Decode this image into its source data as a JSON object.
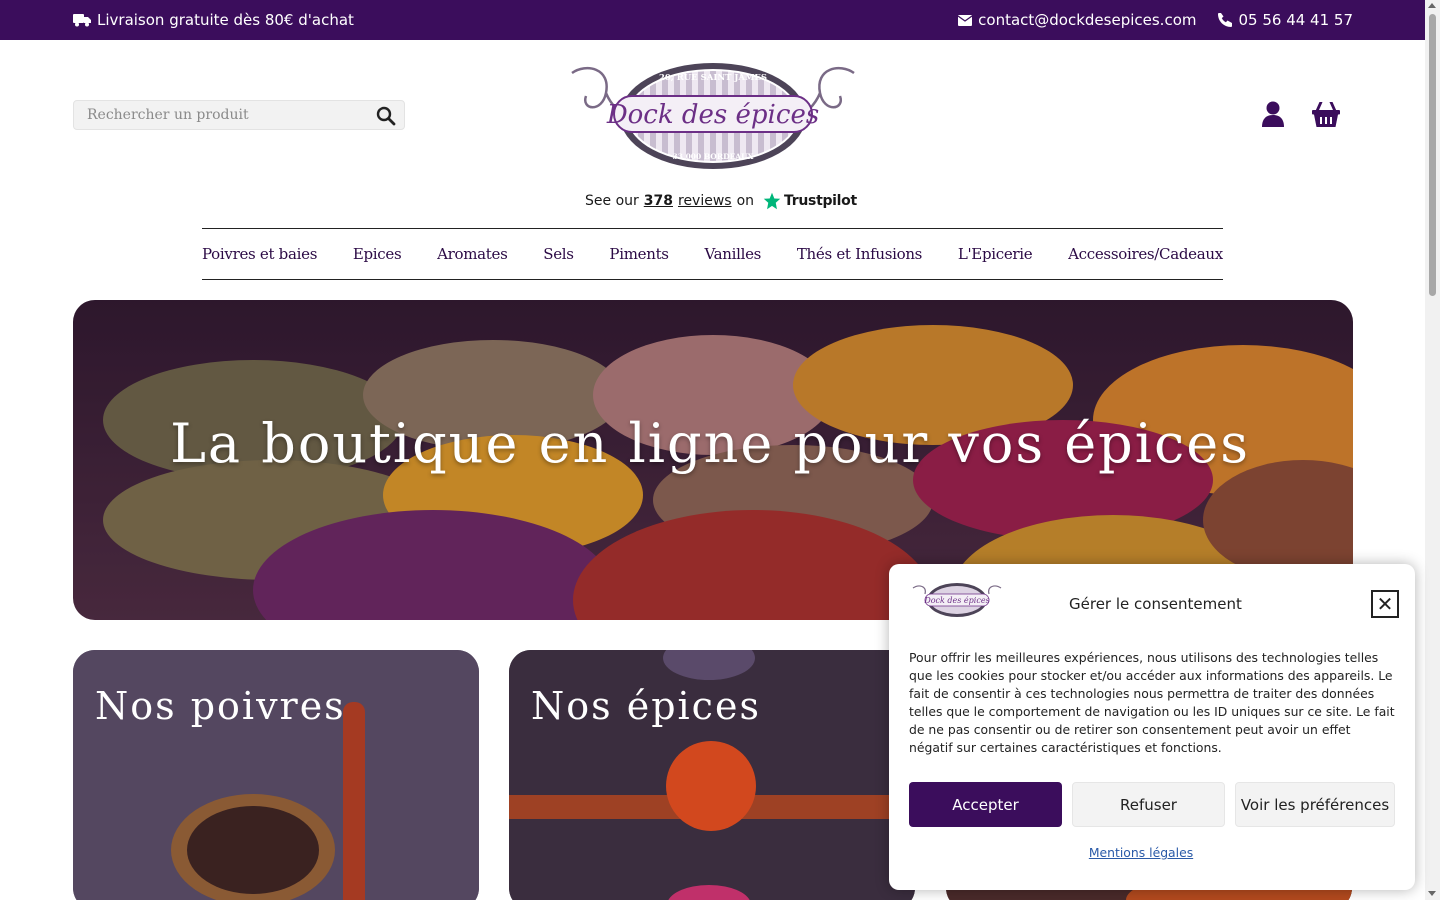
{
  "topbar": {
    "shipping": "Livraison gratuite dès 80€ d'achat",
    "email": "contact@dockdesepices.com",
    "phone": "05 56 44 41 57"
  },
  "search": {
    "placeholder": "Rechercher un produit"
  },
  "logo": {
    "name": "Dock des épices",
    "address_top": "20, RUE SAINT JAMES",
    "address_bottom": "33 000 BORDEAUX"
  },
  "trustpilot": {
    "prefix": "See our",
    "count": "378",
    "reviews": "reviews",
    "on": "on",
    "brand": "Trustpilot"
  },
  "nav": {
    "items": [
      {
        "label": "Poivres et baies"
      },
      {
        "label": "Epices"
      },
      {
        "label": "Aromates"
      },
      {
        "label": "Sels"
      },
      {
        "label": "Piments"
      },
      {
        "label": "Vanilles"
      },
      {
        "label": "Thés et Infusions"
      },
      {
        "label": "L'Epicerie"
      },
      {
        "label": "Accessoires/Cadeaux"
      }
    ]
  },
  "hero": {
    "title": "La boutique en ligne pour vos épices"
  },
  "cards": [
    {
      "title": "Nos poivres"
    },
    {
      "title": "Nos épices"
    },
    {
      "title": ""
    }
  ],
  "cookie": {
    "title": "Gérer le consentement",
    "close": "✕",
    "text": "Pour offrir les meilleures expériences, nous utilisons des technologies telles que les cookies pour stocker et/ou accéder aux informations des appareils. Le fait de consentir à ces technologies nous permettra de traiter des données telles que le comportement de navigation ou les ID uniques sur ce site. Le fait de ne pas consentir ou de retirer son consentement peut avoir un effet négatif sur certaines caractéristiques et fonctions.",
    "accept": "Accepter",
    "refuse": "Refuser",
    "prefs": "Voir les préférences",
    "legal": "Mentions légales"
  },
  "colors": {
    "brand": "#3b0d5c",
    "trustpilot_star": "#00b67a"
  }
}
